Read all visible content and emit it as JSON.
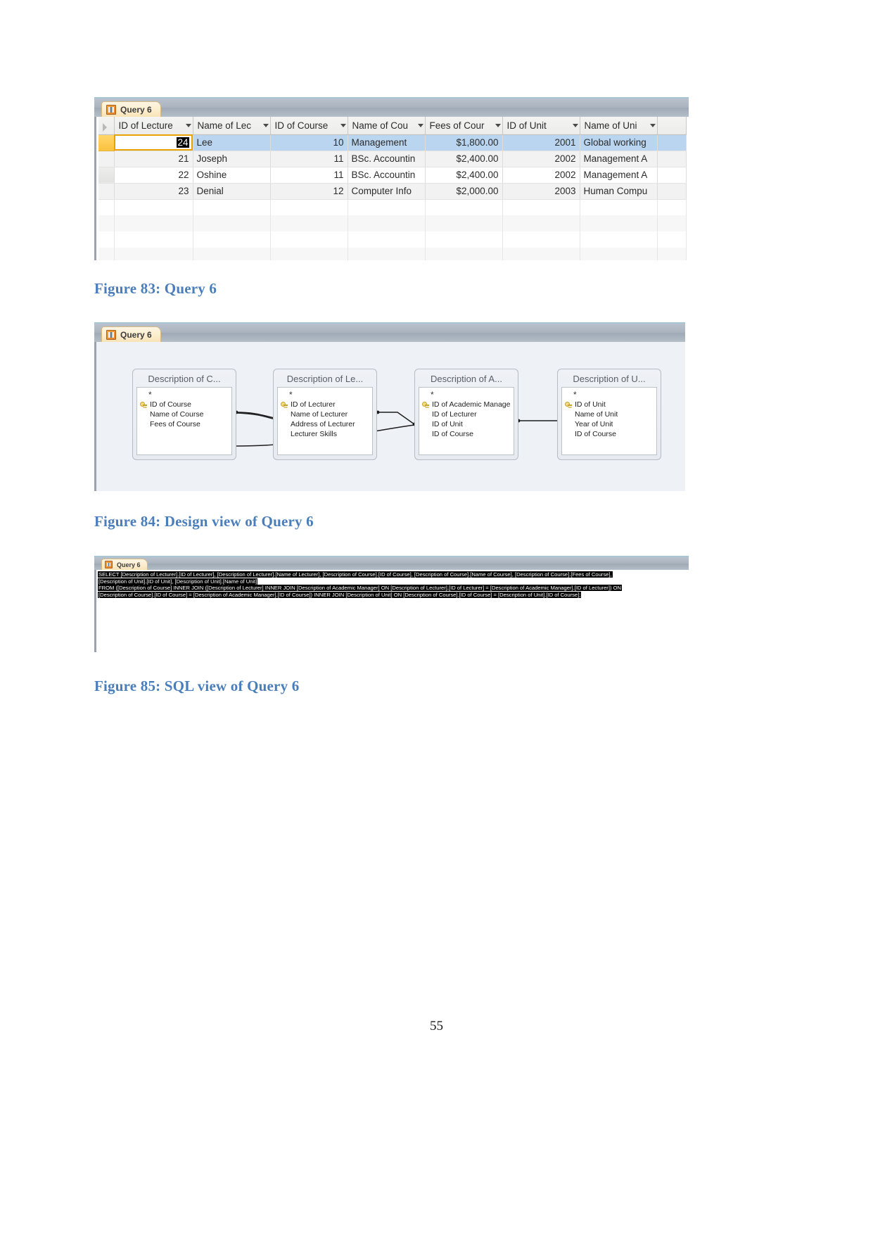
{
  "page": {
    "number": "55"
  },
  "figures": {
    "f83_caption": "Figure 83: Query 6",
    "f84_caption": "Figure 84: Design view of Query 6",
    "f85_caption": "Figure 85: SQL view of Query 6"
  },
  "datasheet": {
    "tab_label": "Query 6",
    "columns": [
      "ID of Lecture",
      "Name of Lec",
      "ID of Course",
      "Name of Cou",
      "Fees of Cour",
      "ID of Unit",
      "Name of Uni"
    ],
    "rows": [
      {
        "id_of_lecturer": "24",
        "name_of_lecturer": "Lee",
        "id_of_course": "10",
        "name_of_course": "Management",
        "fees_of_course": "$1,800.00",
        "id_of_unit": "2001",
        "name_of_unit": "Global working",
        "selected": true
      },
      {
        "id_of_lecturer": "21",
        "name_of_lecturer": "Joseph",
        "id_of_course": "11",
        "name_of_course": "BSc. Accountin",
        "fees_of_course": "$2,400.00",
        "id_of_unit": "2002",
        "name_of_unit": "Management A",
        "selected": false
      },
      {
        "id_of_lecturer": "22",
        "name_of_lecturer": "Oshine",
        "id_of_course": "11",
        "name_of_course": "BSc. Accountin",
        "fees_of_course": "$2,400.00",
        "id_of_unit": "2002",
        "name_of_unit": "Management A",
        "selected": false
      },
      {
        "id_of_lecturer": "23",
        "name_of_lecturer": "Denial",
        "id_of_course": "12",
        "name_of_course": "Computer Info",
        "fees_of_course": "$2,000.00",
        "id_of_unit": "2003",
        "name_of_unit": "Human Compu",
        "selected": false
      }
    ]
  },
  "designview": {
    "tab_label": "Query 6",
    "tables": [
      {
        "title": "Description of C...",
        "fields": [
          {
            "name": "ID of Course",
            "key": true
          },
          {
            "name": "Name of Course",
            "key": false
          },
          {
            "name": "Fees of Course",
            "key": false
          }
        ]
      },
      {
        "title": "Description of Le...",
        "fields": [
          {
            "name": "ID of Lecturer",
            "key": true
          },
          {
            "name": "Name of Lecturer",
            "key": false
          },
          {
            "name": "Address of Lecturer",
            "key": false
          },
          {
            "name": "Lecturer Skills",
            "key": false
          }
        ]
      },
      {
        "title": "Description of A...",
        "fields": [
          {
            "name": "ID of Academic Manager",
            "key": true
          },
          {
            "name": "ID of Lecturer",
            "key": false
          },
          {
            "name": "ID of Unit",
            "key": false
          },
          {
            "name": "ID of Course",
            "key": false
          }
        ]
      },
      {
        "title": "Description of U...",
        "fields": [
          {
            "name": "ID of Unit",
            "key": true
          },
          {
            "name": "Name of Unit",
            "key": false
          },
          {
            "name": "Year of Unit",
            "key": false
          },
          {
            "name": "ID of Course",
            "key": false
          }
        ]
      }
    ]
  },
  "sqlview": {
    "tab_label": "Query 6",
    "lines": [
      "SELECT [Description of Lecturer].[ID of Lecturer], [Description of Lecturer].[Name of Lecturer], [Description of Course].[ID of Course], [Description of Course].[Name of Course], [Description of Course].[Fees of Course],",
      "[Description of Unit].[ID of Unit], [Description of Unit].[Name of Unit]",
      "FROM ([Description of Course] INNER JOIN ([Description of Lecturer] INNER JOIN [Description of Academic Manager] ON [Description of Lecturer].[ID of Lecturer] = [Description of Academic Manager].[ID of Lecturer]) ON",
      "[Description of Course].[ID of Course] = [Description of Academic Manager].[ID of Course]) INNER JOIN [Description of Unit] ON [Description of Course].[ID of Course] = [Description of Unit].[ID of Course];"
    ]
  },
  "colors": {
    "caption": "#4a7ebb",
    "selection_row": "#b9d5f0",
    "record_selector_active": "#fcc23f",
    "tab_bar": "#aab4bf"
  }
}
